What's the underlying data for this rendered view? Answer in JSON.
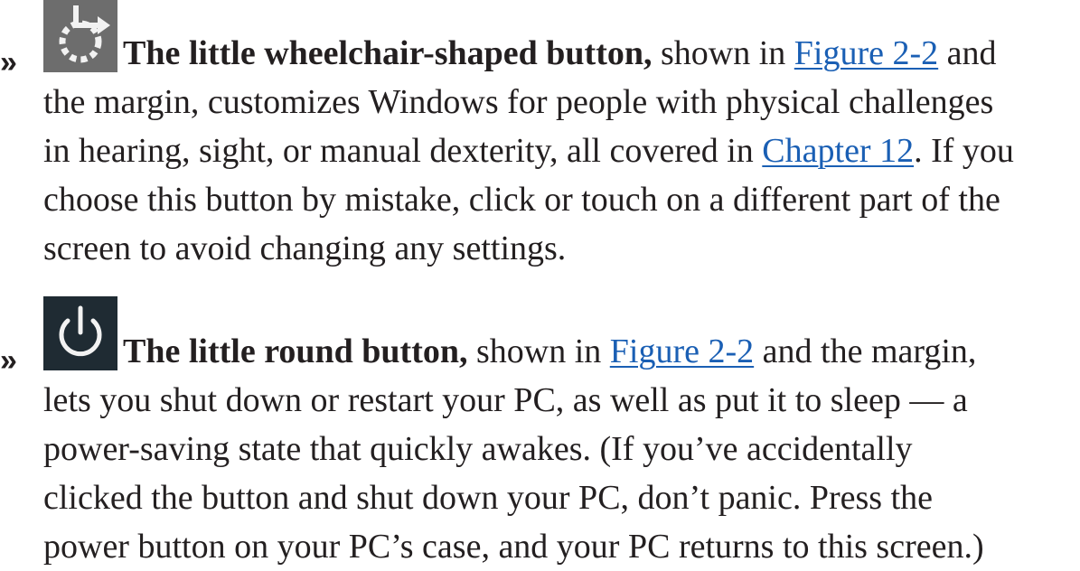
{
  "items": [
    {
      "bullet": "»",
      "icon": "ease-of-access-icon",
      "term": "The little wheelchair-shaped button,",
      "after_term": " shown in ",
      "link1": "Figure 2-2",
      "after_link1": " and",
      "lines": [
        "the margin, customizes Windows for people with physical challenges"
      ],
      "line3_before_link": "in hearing, sight, or manual dexterity, all covered in ",
      "link2": "Chapter 12",
      "line3_after_link": ". If you",
      "tail_lines": [
        "choose this button by mistake, click or touch on a different part of the",
        "screen to avoid changing any settings."
      ]
    },
    {
      "bullet": "»",
      "icon": "power-icon",
      "term": "The little round button,",
      "after_term": " shown in ",
      "link1": "Figure 2-2",
      "after_link1": " and the margin,",
      "lines": [
        "lets you shut down or restart your PC, as well as put it to sleep — a",
        "power-saving state that quickly awakes. (If you’ve accidentally",
        "clicked the button and shut down your PC, don’t panic. Press the",
        "power button on your PC’s case, and your PC returns to this screen.)"
      ]
    }
  ],
  "colors": {
    "text": "#231f20",
    "link": "#1a5fb4",
    "ease_icon_bg": "#6d6d6d",
    "power_icon_bg": "#1f2b33"
  }
}
